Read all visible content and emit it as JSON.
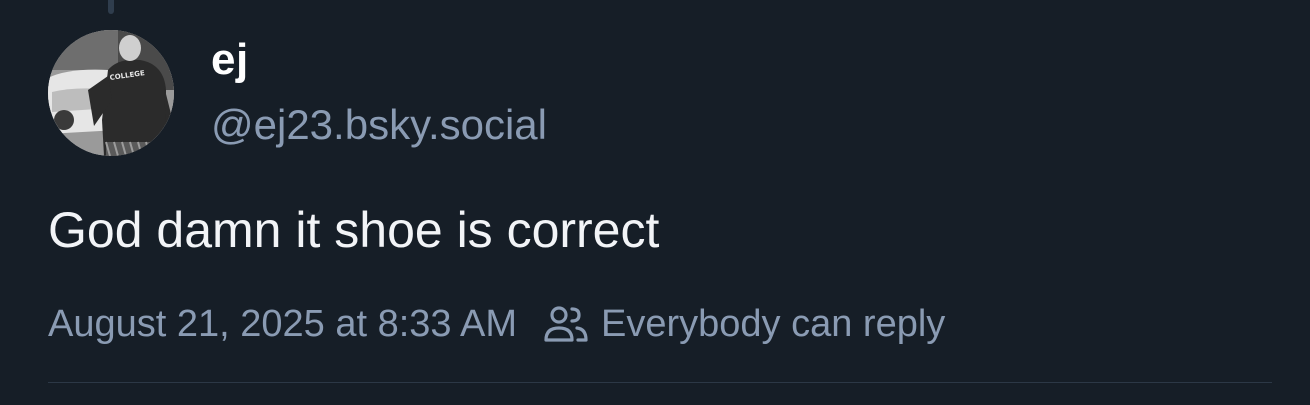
{
  "post": {
    "author": {
      "display_name": "ej",
      "handle": "@ej23.bsky.social",
      "avatar_shirt_text": "COLLEGE"
    },
    "text": "God damn it shoe is correct",
    "timestamp": "August 21, 2025 at 8:33 AM",
    "reply_setting": {
      "label": "Everybody can reply",
      "icon": "people-icon"
    }
  },
  "colors": {
    "background": "#161e27",
    "primary_text": "#f2f4f7",
    "secondary_text": "#8a9bb3",
    "divider": "#2c3846"
  }
}
